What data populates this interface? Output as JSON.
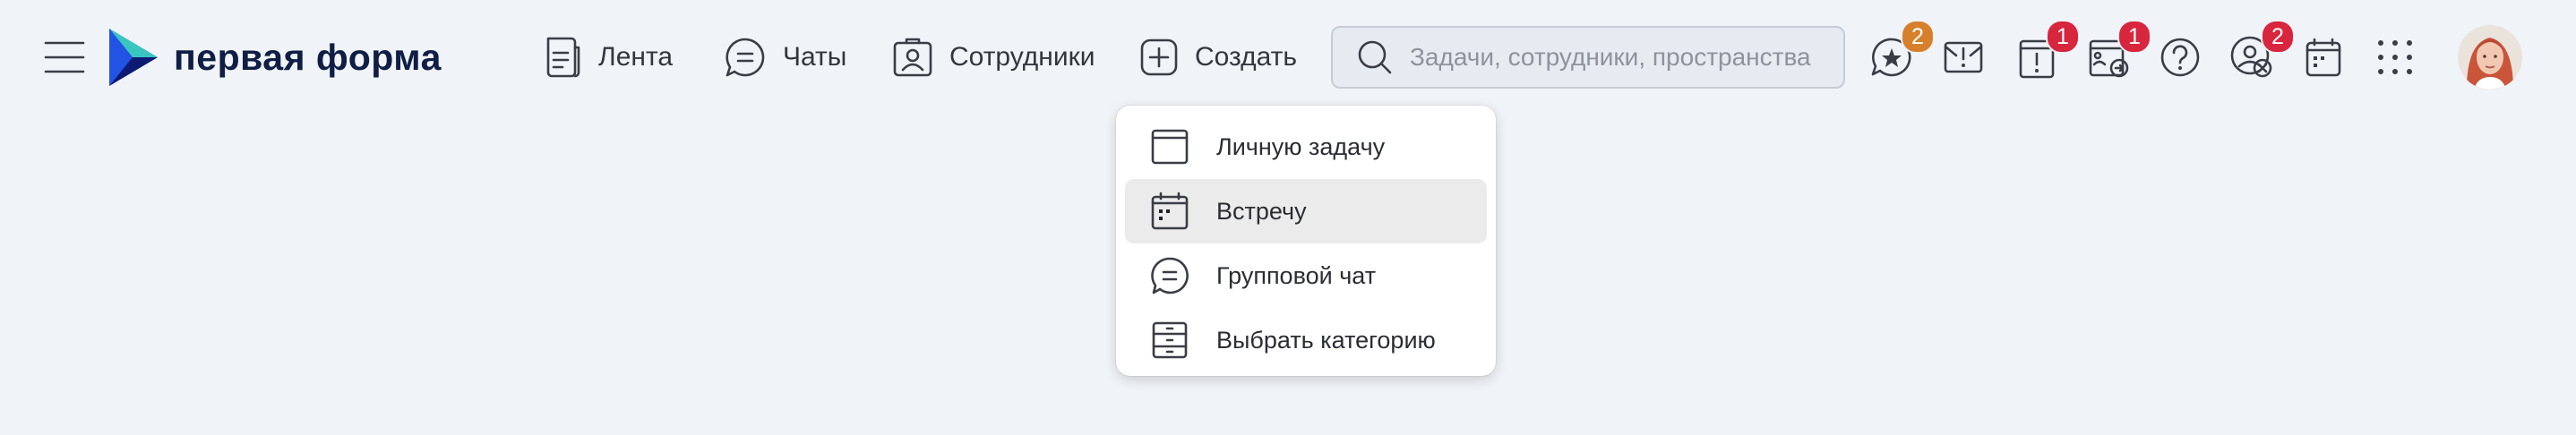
{
  "brand": {
    "name": "первая форма"
  },
  "nav": [
    {
      "label": "Лента",
      "icon": "feed-icon"
    },
    {
      "label": "Чаты",
      "icon": "chat-icon"
    },
    {
      "label": "Сотрудники",
      "icon": "employees-icon"
    },
    {
      "label": "Создать",
      "icon": "plus-icon"
    }
  ],
  "search": {
    "placeholder": "Задачи, сотрудники, пространства",
    "value": ""
  },
  "toolbar": [
    {
      "icon": "favorites-icon",
      "badge": "2",
      "badge_color": "#d6802c"
    },
    {
      "icon": "mail-alert-icon",
      "badge": ""
    },
    {
      "icon": "urgent-tasks-icon",
      "badge": "1",
      "badge_color": "#d7263d"
    },
    {
      "icon": "approvals-icon",
      "badge": "1",
      "badge_color": "#d7263d"
    },
    {
      "icon": "help-icon",
      "badge": ""
    },
    {
      "icon": "user-removed-icon",
      "badge": "2",
      "badge_color": "#d7263d"
    },
    {
      "icon": "calendar-icon",
      "badge": ""
    },
    {
      "icon": "apps-grid-icon",
      "badge": ""
    }
  ],
  "create_menu": {
    "items": [
      {
        "label": "Личную задачу",
        "icon": "task-icon",
        "active": false
      },
      {
        "label": "Встречу",
        "icon": "meeting-calendar-icon",
        "active": true
      },
      {
        "label": "Групповой чат",
        "icon": "group-chat-icon",
        "active": false
      },
      {
        "label": "Выбрать категорию",
        "icon": "category-icon",
        "active": false
      }
    ]
  },
  "colors": {
    "background": "#f0f3f7",
    "badge_orange": "#d6802c",
    "badge_red": "#d7263d",
    "brand_dark": "#0f1e45"
  }
}
